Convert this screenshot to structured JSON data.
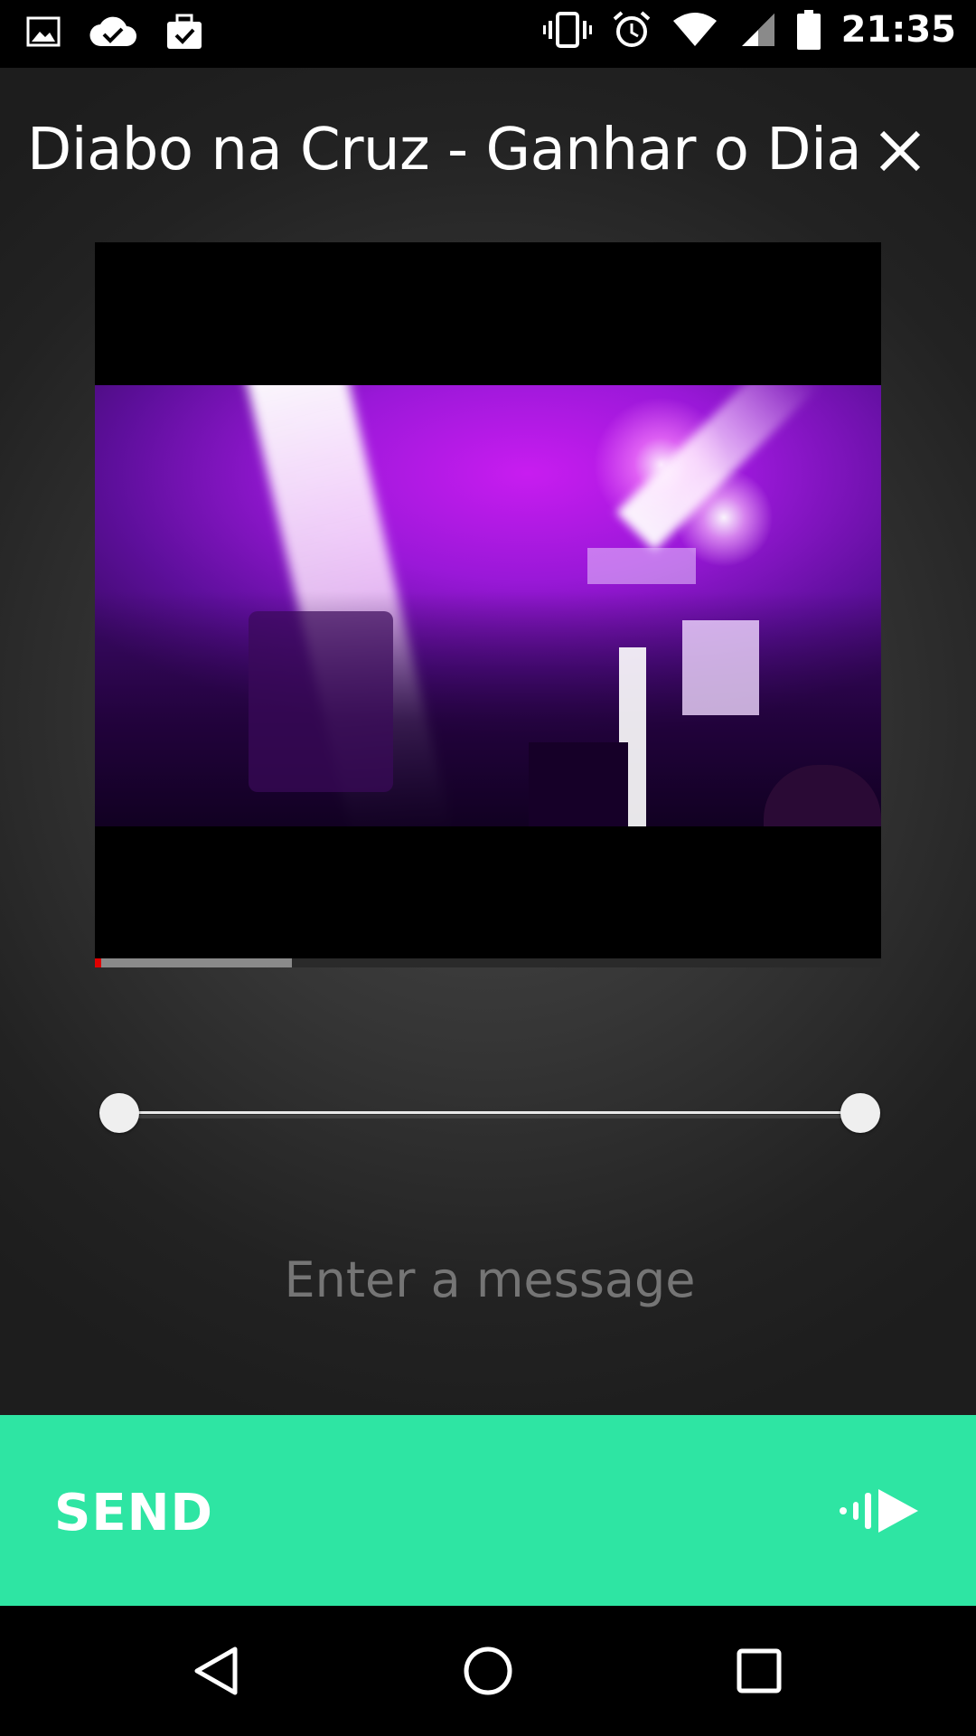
{
  "status_bar": {
    "time": "21:35",
    "left_icons": [
      "image-icon",
      "cloud-done-icon",
      "briefcase-check-icon"
    ],
    "right_icons": [
      "vibrate-icon",
      "alarm-icon",
      "wifi-icon",
      "signal-icon",
      "battery-icon"
    ]
  },
  "header": {
    "title": "Diabo na Cruz - Ganhar o Dia",
    "close_icon": "close-icon"
  },
  "video": {
    "buffered_fraction": 0.25,
    "played_fraction": 0.008
  },
  "trim_slider": {
    "start_fraction": 0.0,
    "end_fraction": 1.0
  },
  "message": {
    "placeholder": "Enter a message",
    "value": ""
  },
  "send_bar": {
    "label": "SEND",
    "icon": "send-audio-play-icon",
    "color": "#2ee5a3"
  },
  "nav_bar": {
    "icons": [
      "back-icon",
      "home-icon",
      "recents-icon"
    ]
  }
}
